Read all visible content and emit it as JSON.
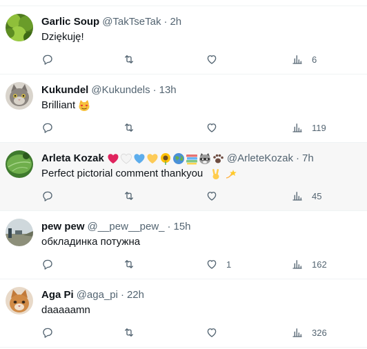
{
  "replies": [
    {
      "name": "Garlic Soup",
      "handle": "@TakTseTak",
      "time": "2h",
      "text": "Dziękuję!",
      "likes": "",
      "views": "6",
      "highlighted": false,
      "avatar": "green-leaves-avatar"
    },
    {
      "name": "Kukundel",
      "handle": "@Kukundels",
      "time": "13h",
      "text": "Brilliant",
      "text_emoji": "smiling-cat-heart-eyes-emoji",
      "likes": "",
      "views": "119",
      "highlighted": false,
      "avatar": "grey-cat-avatar"
    },
    {
      "name": "Arleta Kozak",
      "name_emojis": [
        "red-heart",
        "white-heart",
        "blue-heart",
        "yellow-heart",
        "sunflower",
        "globe",
        "books",
        "raccoon",
        "paw-prints"
      ],
      "handle": "@ArleteKozak",
      "time": "7h",
      "text": "Perfect pictorial comment thankyou",
      "text_emojis": [
        "victory-hand",
        "dizzy-star"
      ],
      "likes": "",
      "views": "45",
      "highlighted": true,
      "avatar": "green-leaf-closeup-avatar"
    },
    {
      "name": "pew pew",
      "handle": "@__pew__pew_",
      "time": "15h",
      "text": "обкладинка потужна",
      "likes": "1",
      "views": "162",
      "highlighted": false,
      "avatar": "landscape-photo-avatar"
    },
    {
      "name": "Aga Pi",
      "handle": "@aga_pi",
      "time": "22h",
      "text": "daaaaamn",
      "likes": "",
      "views": "326",
      "highlighted": false,
      "avatar": "orange-cat-avatar"
    }
  ],
  "separator": "·",
  "icons": {
    "reply": "reply-bubble-icon",
    "retweet": "retweet-arrows-icon",
    "like": "heart-outline-icon",
    "views": "bar-chart-views-icon"
  },
  "colors": {
    "text": "#0f1419",
    "muted": "#536471",
    "highlight_bg": "#f7f7f7",
    "divider": "#eff3f4"
  }
}
